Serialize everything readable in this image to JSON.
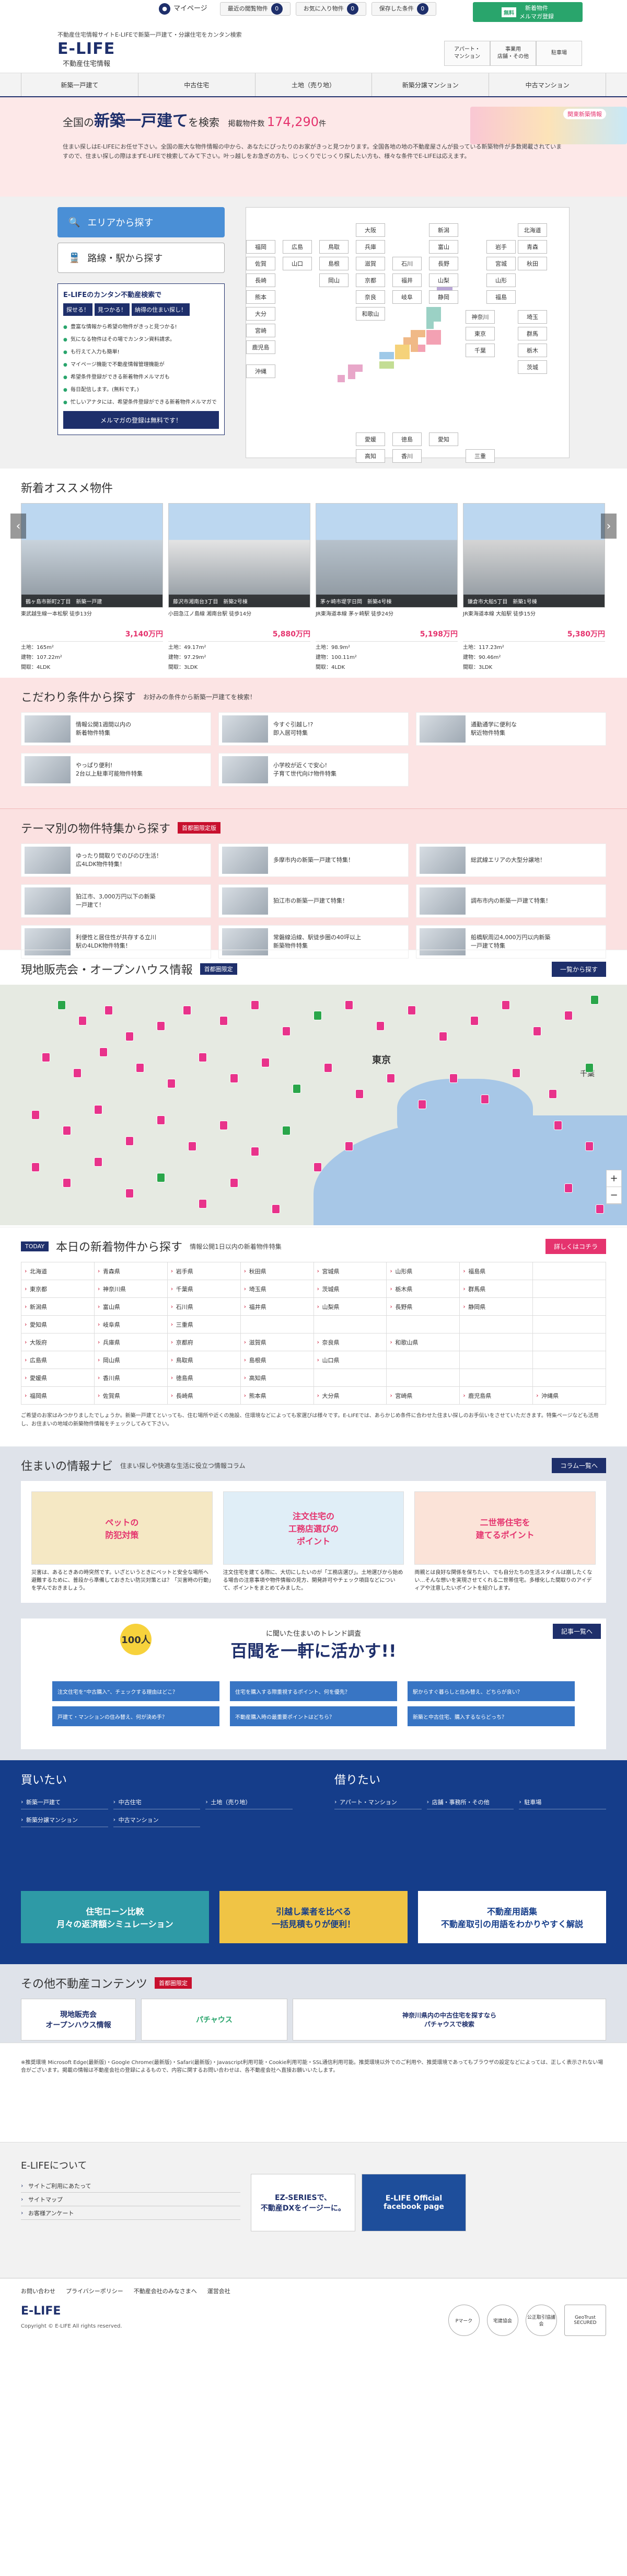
{
  "header": {
    "tagline": "不動産住宅情報サイトE-LIFEで新築一戸建て・分譲住宅をカンタン検索",
    "logo": "E-LIFE",
    "logo_sub": "不動産住宅情報",
    "mypage": "マイページ",
    "recent_label": "最近の閲覧物件",
    "recent_count": "0",
    "fav_label": "お気に入り物件",
    "fav_count": "0",
    "saved_label": "保存した条件",
    "saved_count": "0",
    "mail_free": "無料",
    "mail_label": "新着物件\nメルマガ登録",
    "catlinks": [
      "アパート・\nマンション",
      "事業用\n店舗・その他",
      "駐車場"
    ]
  },
  "gnav": [
    "新築一戸建て",
    "中古住宅",
    "土地（売り地）",
    "新築分譲マンション",
    "中古マンション"
  ],
  "hero": {
    "title_pre": "全国の",
    "title_main": "新築一戸建て",
    "title_post": "を検索",
    "count_label": "掲載物件数",
    "count": "174,290",
    "count_unit": "件",
    "desc": "住まい探しはE-LIFEにお任せ下さい。全国の膨大な物件情報の中から、あなたにぴったりのお家がきっと見つかります。全国各地の地の不動産屋さんが扱っている新築物件が多数掲載されていますので、住まい探しの際はまずE-LIFEで検索してみて下さい。叶っ越しをお急ぎの方も、じっくりでじっくり探したい方も、様々な条件でE-LIFEは応えます。",
    "illus_label": "関東新築情報"
  },
  "search": {
    "tab_area": "エリアから探す",
    "tab_station": "路線・駅から探す",
    "promo_title": "E-LIFEのカンタン不動産検索で",
    "promo_steps": [
      "探せる！",
      "見つかる！",
      "納得の住まい探し！"
    ],
    "promo_items": [
      "豊富な情報から希望の物件がきっと見つかる!",
      "気になる物件はその場でカンタン資料請求。",
      "も行えて入力も簡単!",
      "マイページ機能で不動産情報管理機能が",
      "希望条件登録ができる新着物件メルマガも",
      "毎日配信します。(無料です。)",
      "忙しいアナタには、希望条件登録ができる新着物件メルマガで"
    ],
    "promo_button": "メルマガの登録は無料です！",
    "prefs": [
      {
        "n": "北海道"
      },
      {
        "n": "青森"
      },
      {
        "n": "秋田"
      },
      {
        "n": "岩手"
      },
      {
        "n": "宮城"
      },
      {
        "n": "山形"
      },
      {
        "n": "福島"
      },
      {
        "n": "新潟"
      },
      {
        "n": "富山"
      },
      {
        "n": "石川"
      },
      {
        "n": "福井"
      },
      {
        "n": "長野"
      },
      {
        "n": "岐阜"
      },
      {
        "n": "山梨"
      },
      {
        "n": "静岡"
      },
      {
        "n": "愛知"
      },
      {
        "n": "三重"
      },
      {
        "n": "滋賀"
      },
      {
        "n": "京都"
      },
      {
        "n": "大阪"
      },
      {
        "n": "兵庫"
      },
      {
        "n": "奈良"
      },
      {
        "n": "和歌山"
      },
      {
        "n": "鳥取"
      },
      {
        "n": "島根"
      },
      {
        "n": "岡山"
      },
      {
        "n": "広島"
      },
      {
        "n": "山口"
      },
      {
        "n": "徳島"
      },
      {
        "n": "香川"
      },
      {
        "n": "愛媛"
      },
      {
        "n": "高知"
      },
      {
        "n": "福岡"
      },
      {
        "n": "佐賀"
      },
      {
        "n": "長崎"
      },
      {
        "n": "熊本"
      },
      {
        "n": "大分"
      },
      {
        "n": "宮崎"
      },
      {
        "n": "鹿児島"
      },
      {
        "n": "沖縄"
      },
      {
        "n": "栃木"
      },
      {
        "n": "茨城"
      },
      {
        "n": "群馬"
      },
      {
        "n": "埼玉"
      },
      {
        "n": "千葉"
      },
      {
        "n": "東京"
      },
      {
        "n": "神奈川"
      }
    ]
  },
  "newlist": {
    "title": "新着オススメ物件",
    "cards": [
      {
        "label": "鶴ヶ島市新町2丁目　新築一戸建",
        "cap": "東武越生線一本松駅 徒歩13分",
        "price": "3,140万円",
        "land": "土地：165m²",
        "bldg": "建物：107.22m²",
        "plan": "間取：4LDK"
      },
      {
        "label": "藤沢市湘南台3丁目　新築2号棟",
        "cap": "小田急江ノ島線 湘南台駅 徒歩14分",
        "price": "5,880万円",
        "land": "土地：49.17m²",
        "bldg": "建物：97.29m²",
        "plan": "間取：3LDK"
      },
      {
        "label": "茅ヶ崎市堤字日岡　新築4号棟",
        "cap": "JR東海道本線 茅ヶ崎駅 徒歩24分",
        "price": "5,198万円",
        "land": "土地：98.9m²",
        "bldg": "建物：100.11m²",
        "plan": "間取：4LDK"
      },
      {
        "label": "鎌倉市大船5丁目　新築1号棟",
        "cap": "JR東海道本線 大船駅 徒歩15分",
        "price": "5,380万円",
        "land": "土地：117.23m²",
        "bldg": "建物：90.46m²",
        "plan": "間取：3LDK"
      }
    ]
  },
  "cond": {
    "title": "こだわり条件から探す",
    "sub": "お好みの条件から新築一戸建てを検索！",
    "items": [
      "情報公開1週間以内の\n新着物件特集",
      "今すぐ引越し!?\n即入居可特集",
      "通勤通学に便利な\n駅近物件特集",
      "やっぱり便利!\n2台以上駐車可能物件特集",
      "小学校が近くで安心!\n子育て世代向け物件特集"
    ]
  },
  "theme": {
    "title": "テーマ別の物件特集から探す",
    "tag": "首都圏限定版",
    "items": [
      "ゆったり間取りでのびのび生活！\n広4LDK物件特集！",
      "多摩市内の新築一戸建て特集！",
      "総武線エリアの大型分譲地！",
      "狛江市、3,000万円以下の新築\n一戸建て！",
      "狛江市の新築一戸建て特集！",
      "調布市内の新築一戸建て特集！",
      "利便性と居住性が共存する立川\n駅の4LDK物件特集！",
      "常磐線沿線、駅徒歩圏の40坪以上\n新築物件特集",
      "船橋駅周辺4,000万円以内新築\n一戸建て特集"
    ]
  },
  "mapsec": {
    "title": "現地販売会・オープンハウス情報",
    "tag": "首都圏限定",
    "more": "一覧から探す",
    "city_label": "東京",
    "city2": "千葉"
  },
  "today": {
    "badge": "TODAY",
    "title": "本日の新着物件から探す",
    "sub": "情報公開1日以内の新着物件特集",
    "more": "詳しくはコチラ",
    "prefs": [
      "北海道",
      "青森県",
      "岩手県",
      "秋田県",
      "宮城県",
      "山形県",
      "福島県",
      "",
      "東京都",
      "神奈川県",
      "千葉県",
      "埼玉県",
      "茨城県",
      "栃木県",
      "群馬県",
      "",
      "新潟県",
      "富山県",
      "石川県",
      "福井県",
      "山梨県",
      "長野県",
      "静岡県",
      "",
      "愛知県",
      "岐阜県",
      "三重県",
      "",
      "",
      "",
      "",
      "",
      "大阪府",
      "兵庫県",
      "京都府",
      "滋賀県",
      "奈良県",
      "和歌山県",
      "",
      "",
      "広島県",
      "岡山県",
      "鳥取県",
      "島根県",
      "山口県",
      "",
      "",
      "",
      "愛媛県",
      "香川県",
      "徳島県",
      "高知県",
      "",
      "",
      "",
      "",
      "福岡県",
      "佐賀県",
      "長崎県",
      "熊本県",
      "大分県",
      "宮崎県",
      "鹿児島県",
      "沖縄県"
    ],
    "desc": "ご希望のお家はみつかりましたでしょうか。新築一戸建てといっても、住む場所や近くの施設、住環境などによっても家選びは様々です。E-LIFEでは、あらかじめ条件に合わせた住まい探しのお手伝いをさせていただきます。特集ページなども活用し、お住まいの地域の新築物件情報をチェックしてみて下さい。"
  },
  "navi": {
    "title": "住まいの情報ナビ",
    "sub": "住まい探しや快適な生活に役立つ情報コラム",
    "more": "コラム一覧へ",
    "cards": [
      {
        "img": "ペットの\n防犯対策",
        "tx": "災害は、あるときあの時突然です。いざというときにペットと安全な場所へ避難するために、普段から準備しておきたい防災対策とは？「災害時の行動」を学んでおきましょう。"
      },
      {
        "img": "注文住宅の\n工務店選びの\nポイント",
        "tx": "注文住宅を建てる際に、大切にしたいのが「工務店選び」。土地選びから始める場合の注意事項や物件情報の見方、開発許可やチェック項目などについて、ポイントをまとめてみました。"
      },
      {
        "img": "二世帯住宅を\n建てるポイント",
        "tx": "両親とは良好な関係を保ちたい、でも自分たちの生活スタイルは崩したくない…そんな想いを実現させてくれる二世帯住宅。多様化した間取りのアイディアや注意したいポイントを紹介します。"
      }
    ],
    "survey_badge": "100人",
    "survey_s1": "に聞いた住まいのトレンド調査",
    "survey_s2": "百聞を一軒に活かす!!",
    "survey_more": "記事一覧へ",
    "survey_cats": [
      "注文住宅を“中古購入”、チェックする理由はどこ？",
      "住宅を購入する際重視するポイント、何を優先？",
      "駅からすぐ暮らしと住み替え、どちらが良い？",
      "戸建て・マンションの住み替え、何が決め手？",
      "不動産購入時の最重要ポイントはどちら？",
      "新築と中古住宅、購入するならどっち？"
    ]
  },
  "buy": {
    "buy_title": "買いたい",
    "buy_items": [
      "新築一戸建て",
      "中古住宅",
      "土地（売り地）",
      "新築分譲マンション",
      "中古マンション"
    ],
    "rent_title": "借りたい",
    "rent_items": [
      "アパート・マンション",
      "店舗・事務所・その他",
      "駐車場"
    ],
    "banners": [
      "住宅ローン比較\n月々の返済額シミュレーション",
      "引越し業者を比べる\n一括見積もりが便利！",
      "不動産用語集\n不動産取引の用語をわかりやすく解説"
    ]
  },
  "other": {
    "title": "その他不動産コンテンツ",
    "tag": "首都圏限定",
    "items": [
      "現地販売会\nオープンハウス情報",
      "パチャウス",
      "神奈川県内の中古住宅を探すなら\nパチャウスで検索"
    ]
  },
  "note": {
    "text": "※推奨環境 Microsoft Edge(最新版)・Google Chrome(最新版)・Safari(最新版)・Javascript利用可能・Cookie利用可能・SSL通信利用可能。推奨環境以外でのご利用や、推奨環境であってもブラウザの設定などによっては、正しく表示されない場合がございます。掲載の情報は不動産会社の登録によるもので、内容に関するお問い合わせは、各不動産会社へ直接お願いいたします。"
  },
  "about": {
    "title": "E-LIFEについて",
    "items": [
      "サイトご利用にあたって",
      "サイトマップ",
      "お客様アンケート"
    ],
    "banners": [
      "EZ-SERIESで、\n不動産DXをイージーに。",
      "E-LIFE Official\nfacebook page"
    ]
  },
  "footer": {
    "links": [
      "お問い合わせ",
      "プライバシーポリシー",
      "不動産会社のみなさまへ",
      "運営会社"
    ],
    "logo": "E-LIFE",
    "copy": "Copyright © E-LIFE All rights reserved.",
    "seals": [
      "Pマーク",
      "宅建協会",
      "公正取引協議会",
      "GeoTrust\nSECURED"
    ]
  }
}
